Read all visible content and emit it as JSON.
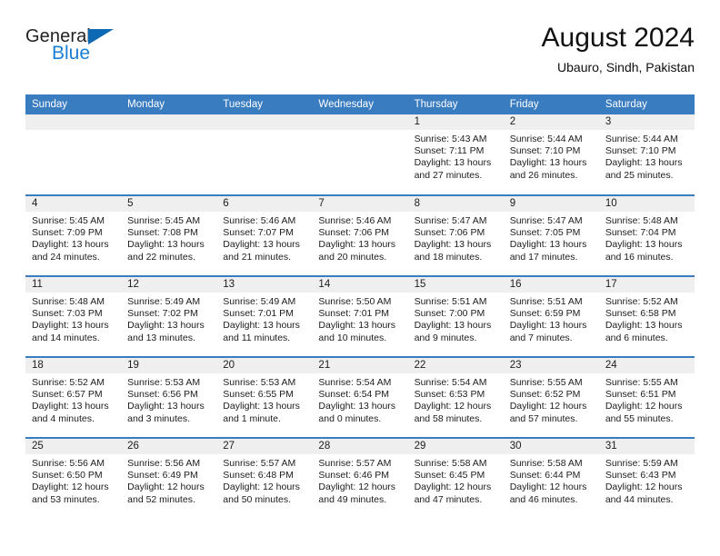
{
  "brand": {
    "name_part1": "General",
    "name_part2": "Blue",
    "triangle_icon": "triangle-icon",
    "colors": {
      "general": "#231f20",
      "blue": "#1a7fd4",
      "triangle": "#0d69b4"
    }
  },
  "header": {
    "title": "August 2024",
    "subtitle": "Ubauro, Sindh, Pakistan"
  },
  "theme": {
    "header_blue": "#3a7cc0",
    "daynum_band": "#efefef",
    "cell_background": "#ffffff",
    "text": "#1c1c1c"
  },
  "weekdays": [
    {
      "label": "Sunday"
    },
    {
      "label": "Monday"
    },
    {
      "label": "Tuesday"
    },
    {
      "label": "Wednesday"
    },
    {
      "label": "Thursday"
    },
    {
      "label": "Friday"
    },
    {
      "label": "Saturday"
    }
  ],
  "weeks": [
    [
      {
        "day": "",
        "empty": true
      },
      {
        "day": "",
        "empty": true
      },
      {
        "day": "",
        "empty": true
      },
      {
        "day": "",
        "empty": true
      },
      {
        "day": "1",
        "sunrise": "Sunrise: 5:43 AM",
        "sunset": "Sunset: 7:11 PM",
        "daylight_line1": "Daylight: 13 hours",
        "daylight_line2": "and 27 minutes."
      },
      {
        "day": "2",
        "sunrise": "Sunrise: 5:44 AM",
        "sunset": "Sunset: 7:10 PM",
        "daylight_line1": "Daylight: 13 hours",
        "daylight_line2": "and 26 minutes."
      },
      {
        "day": "3",
        "sunrise": "Sunrise: 5:44 AM",
        "sunset": "Sunset: 7:10 PM",
        "daylight_line1": "Daylight: 13 hours",
        "daylight_line2": "and 25 minutes."
      }
    ],
    [
      {
        "day": "4",
        "sunrise": "Sunrise: 5:45 AM",
        "sunset": "Sunset: 7:09 PM",
        "daylight_line1": "Daylight: 13 hours",
        "daylight_line2": "and 24 minutes."
      },
      {
        "day": "5",
        "sunrise": "Sunrise: 5:45 AM",
        "sunset": "Sunset: 7:08 PM",
        "daylight_line1": "Daylight: 13 hours",
        "daylight_line2": "and 22 minutes."
      },
      {
        "day": "6",
        "sunrise": "Sunrise: 5:46 AM",
        "sunset": "Sunset: 7:07 PM",
        "daylight_line1": "Daylight: 13 hours",
        "daylight_line2": "and 21 minutes."
      },
      {
        "day": "7",
        "sunrise": "Sunrise: 5:46 AM",
        "sunset": "Sunset: 7:06 PM",
        "daylight_line1": "Daylight: 13 hours",
        "daylight_line2": "and 20 minutes."
      },
      {
        "day": "8",
        "sunrise": "Sunrise: 5:47 AM",
        "sunset": "Sunset: 7:06 PM",
        "daylight_line1": "Daylight: 13 hours",
        "daylight_line2": "and 18 minutes."
      },
      {
        "day": "9",
        "sunrise": "Sunrise: 5:47 AM",
        "sunset": "Sunset: 7:05 PM",
        "daylight_line1": "Daylight: 13 hours",
        "daylight_line2": "and 17 minutes."
      },
      {
        "day": "10",
        "sunrise": "Sunrise: 5:48 AM",
        "sunset": "Sunset: 7:04 PM",
        "daylight_line1": "Daylight: 13 hours",
        "daylight_line2": "and 16 minutes."
      }
    ],
    [
      {
        "day": "11",
        "sunrise": "Sunrise: 5:48 AM",
        "sunset": "Sunset: 7:03 PM",
        "daylight_line1": "Daylight: 13 hours",
        "daylight_line2": "and 14 minutes."
      },
      {
        "day": "12",
        "sunrise": "Sunrise: 5:49 AM",
        "sunset": "Sunset: 7:02 PM",
        "daylight_line1": "Daylight: 13 hours",
        "daylight_line2": "and 13 minutes."
      },
      {
        "day": "13",
        "sunrise": "Sunrise: 5:49 AM",
        "sunset": "Sunset: 7:01 PM",
        "daylight_line1": "Daylight: 13 hours",
        "daylight_line2": "and 11 minutes."
      },
      {
        "day": "14",
        "sunrise": "Sunrise: 5:50 AM",
        "sunset": "Sunset: 7:01 PM",
        "daylight_line1": "Daylight: 13 hours",
        "daylight_line2": "and 10 minutes."
      },
      {
        "day": "15",
        "sunrise": "Sunrise: 5:51 AM",
        "sunset": "Sunset: 7:00 PM",
        "daylight_line1": "Daylight: 13 hours",
        "daylight_line2": "and 9 minutes."
      },
      {
        "day": "16",
        "sunrise": "Sunrise: 5:51 AM",
        "sunset": "Sunset: 6:59 PM",
        "daylight_line1": "Daylight: 13 hours",
        "daylight_line2": "and 7 minutes."
      },
      {
        "day": "17",
        "sunrise": "Sunrise: 5:52 AM",
        "sunset": "Sunset: 6:58 PM",
        "daylight_line1": "Daylight: 13 hours",
        "daylight_line2": "and 6 minutes."
      }
    ],
    [
      {
        "day": "18",
        "sunrise": "Sunrise: 5:52 AM",
        "sunset": "Sunset: 6:57 PM",
        "daylight_line1": "Daylight: 13 hours",
        "daylight_line2": "and 4 minutes."
      },
      {
        "day": "19",
        "sunrise": "Sunrise: 5:53 AM",
        "sunset": "Sunset: 6:56 PM",
        "daylight_line1": "Daylight: 13 hours",
        "daylight_line2": "and 3 minutes."
      },
      {
        "day": "20",
        "sunrise": "Sunrise: 5:53 AM",
        "sunset": "Sunset: 6:55 PM",
        "daylight_line1": "Daylight: 13 hours",
        "daylight_line2": "and 1 minute."
      },
      {
        "day": "21",
        "sunrise": "Sunrise: 5:54 AM",
        "sunset": "Sunset: 6:54 PM",
        "daylight_line1": "Daylight: 13 hours",
        "daylight_line2": "and 0 minutes."
      },
      {
        "day": "22",
        "sunrise": "Sunrise: 5:54 AM",
        "sunset": "Sunset: 6:53 PM",
        "daylight_line1": "Daylight: 12 hours",
        "daylight_line2": "and 58 minutes."
      },
      {
        "day": "23",
        "sunrise": "Sunrise: 5:55 AM",
        "sunset": "Sunset: 6:52 PM",
        "daylight_line1": "Daylight: 12 hours",
        "daylight_line2": "and 57 minutes."
      },
      {
        "day": "24",
        "sunrise": "Sunrise: 5:55 AM",
        "sunset": "Sunset: 6:51 PM",
        "daylight_line1": "Daylight: 12 hours",
        "daylight_line2": "and 55 minutes."
      }
    ],
    [
      {
        "day": "25",
        "sunrise": "Sunrise: 5:56 AM",
        "sunset": "Sunset: 6:50 PM",
        "daylight_line1": "Daylight: 12 hours",
        "daylight_line2": "and 53 minutes."
      },
      {
        "day": "26",
        "sunrise": "Sunrise: 5:56 AM",
        "sunset": "Sunset: 6:49 PM",
        "daylight_line1": "Daylight: 12 hours",
        "daylight_line2": "and 52 minutes."
      },
      {
        "day": "27",
        "sunrise": "Sunrise: 5:57 AM",
        "sunset": "Sunset: 6:48 PM",
        "daylight_line1": "Daylight: 12 hours",
        "daylight_line2": "and 50 minutes."
      },
      {
        "day": "28",
        "sunrise": "Sunrise: 5:57 AM",
        "sunset": "Sunset: 6:46 PM",
        "daylight_line1": "Daylight: 12 hours",
        "daylight_line2": "and 49 minutes."
      },
      {
        "day": "29",
        "sunrise": "Sunrise: 5:58 AM",
        "sunset": "Sunset: 6:45 PM",
        "daylight_line1": "Daylight: 12 hours",
        "daylight_line2": "and 47 minutes."
      },
      {
        "day": "30",
        "sunrise": "Sunrise: 5:58 AM",
        "sunset": "Sunset: 6:44 PM",
        "daylight_line1": "Daylight: 12 hours",
        "daylight_line2": "and 46 minutes."
      },
      {
        "day": "31",
        "sunrise": "Sunrise: 5:59 AM",
        "sunset": "Sunset: 6:43 PM",
        "daylight_line1": "Daylight: 12 hours",
        "daylight_line2": "and 44 minutes."
      }
    ]
  ]
}
